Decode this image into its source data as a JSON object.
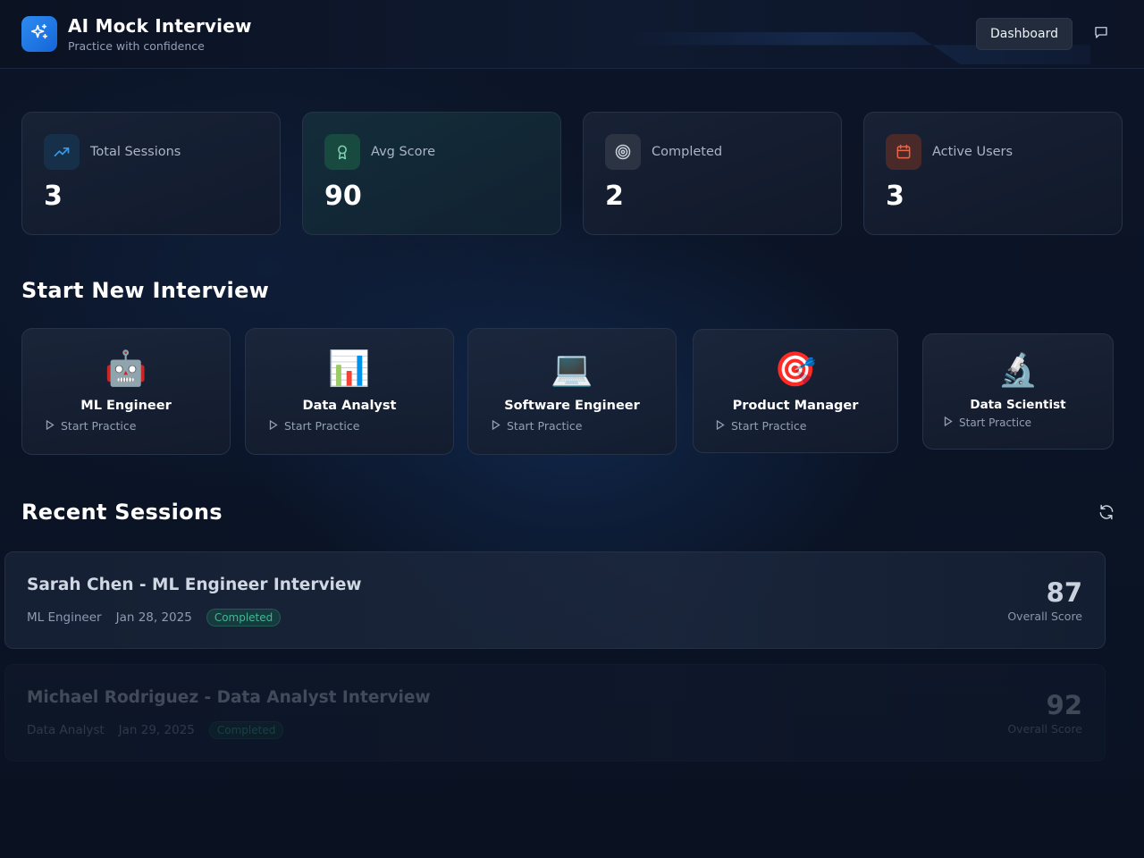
{
  "header": {
    "title": "AI Mock Interview",
    "subtitle": "Practice with confidence",
    "dashboard_label": "Dashboard",
    "logo_icon": "sparkles-icon",
    "chat_icon": "message-square-icon"
  },
  "stats": [
    {
      "label": "Total Sessions",
      "value": "3",
      "icon": "trending-up-icon",
      "color": "#3b9ae8"
    },
    {
      "label": "Avg Score",
      "value": "90",
      "icon": "award-icon",
      "color": "#3fb894"
    },
    {
      "label": "Completed",
      "value": "2",
      "icon": "target-icon",
      "color": "#c8d0dc"
    },
    {
      "label": "Active Users",
      "value": "3",
      "icon": "calendar-icon",
      "color": "#e8664a"
    }
  ],
  "start_section": {
    "title": "Start New Interview",
    "roles": [
      {
        "name": "ML Engineer",
        "emoji": "🤖",
        "action": "Start Practice"
      },
      {
        "name": "Data Analyst",
        "emoji": "📊",
        "action": "Start Practice"
      },
      {
        "name": "Software Engineer",
        "emoji": "💻",
        "action": "Start Practice"
      },
      {
        "name": "Product Manager",
        "emoji": "🎯",
        "action": "Start Practice"
      },
      {
        "name": "Data Scientist",
        "emoji": "🔬",
        "action": "Start Practice"
      }
    ]
  },
  "recent_section": {
    "title": "Recent Sessions",
    "refresh_icon": "refresh-icon",
    "sessions": [
      {
        "title": "Sarah Chen - ML Engineer Interview",
        "role": "ML Engineer",
        "date": "Jan 28, 2025",
        "status": "Completed",
        "score": "87",
        "score_label": "Overall Score"
      },
      {
        "title": "Michael Rodriguez - Data Analyst Interview",
        "role": "Data Analyst",
        "date": "Jan 29, 2025",
        "status": "Completed",
        "score": "92",
        "score_label": "Overall Score"
      }
    ]
  }
}
